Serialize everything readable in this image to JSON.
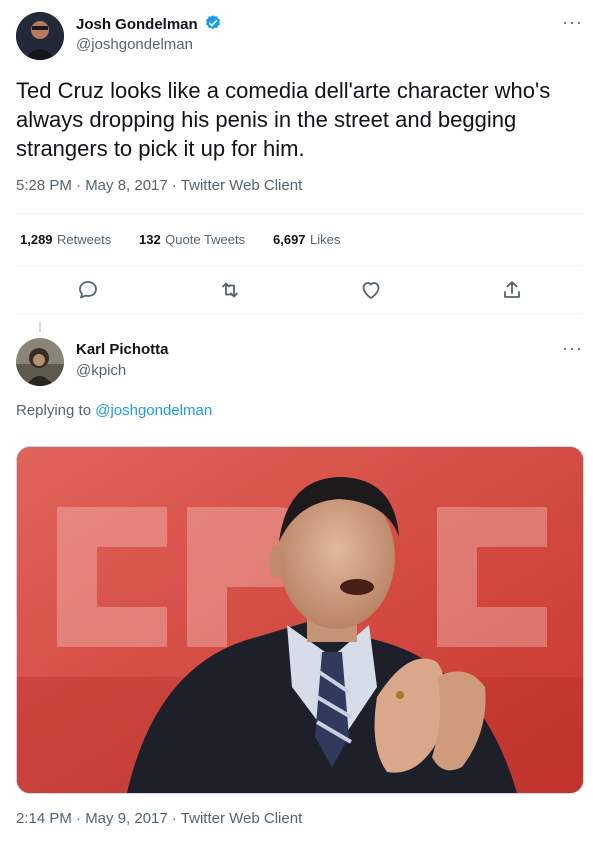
{
  "main_tweet": {
    "author_name": "Josh Gondelman",
    "author_handle": "@joshgondelman",
    "more_label": "···",
    "text": "Ted Cruz looks like a comedia dell'arte character who's always dropping his penis in the street and begging strangers to pick it up for him.",
    "timestamp": "5:28 PM · May 8, 2017 · Twitter Web Client",
    "stats": {
      "retweets_count": "1,289",
      "retweets_label": "Retweets",
      "quotes_count": "132",
      "quotes_label": "Quote Tweets",
      "likes_count": "6,697",
      "likes_label": "Likes"
    },
    "actions": [
      "reply-icon",
      "retweet-icon",
      "like-icon",
      "share-icon"
    ]
  },
  "reply_tweet": {
    "author_name": "Karl Pichotta",
    "author_handle": "@kpich",
    "more_label": "···",
    "replying_prefix": "Replying to",
    "replying_to": "@joshgondelman",
    "timestamp": "2:14 PM · May 9, 2017 · Twitter Web Client"
  },
  "colors": {
    "verified_blue": "#1d9bf0",
    "secondary_text": "#536471",
    "link_blue": "#1d9bf0",
    "photo_background_red": "#d94a44"
  }
}
